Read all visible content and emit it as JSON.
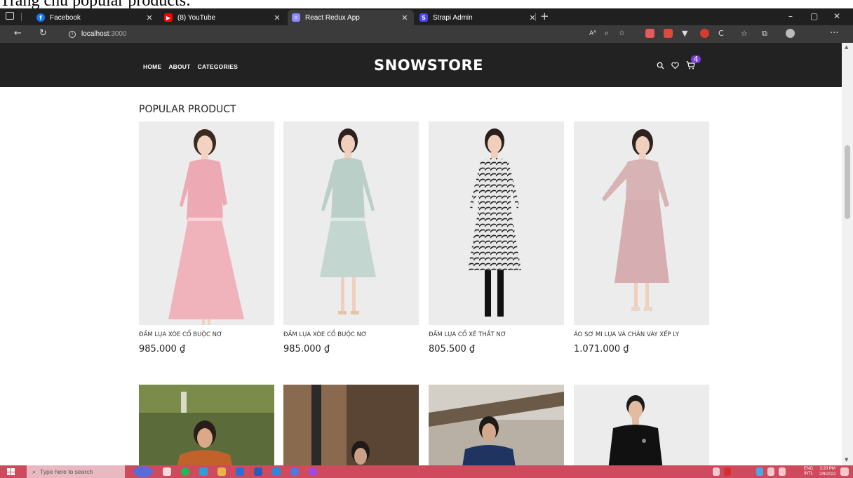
{
  "caption": "Trang chủ popular products:",
  "browser": {
    "tabs": [
      {
        "title": "Facebook",
        "icon": "facebook-icon",
        "color": "#1877f2"
      },
      {
        "title": "(8) YouTube",
        "icon": "youtube-icon",
        "color": "#ff0000"
      },
      {
        "title": "React Redux App",
        "icon": "react-icon",
        "color": "#8a8aff"
      },
      {
        "title": "Strapi Admin",
        "icon": "strapi-icon",
        "color": "#4945ff"
      }
    ],
    "new_tab": "+",
    "url_host": "localhost",
    "url_port": ":3000"
  },
  "site": {
    "nav": [
      "HOME",
      "ABOUT",
      "CATEGORIES"
    ],
    "brand": "SNOWSTORE",
    "cart_count": "4"
  },
  "section_title": "POPULAR PRODUCT",
  "products": [
    {
      "name": "ĐẦM LỤA XÒE CỔ BUỘC NƠ",
      "price": "985.000 ₫",
      "dress_color": "#eeaab4"
    },
    {
      "name": "ĐẦM LỤA XÒE CỔ BUỘC NƠ",
      "price": "985.000 ₫",
      "dress_color": "#b9cfc8"
    },
    {
      "name": "ĐẦM LỤA CỔ XẺ THẮT NƠ",
      "price": "805.500 ₫",
      "dress_color": "#4a4a4a"
    },
    {
      "name": "ÁO SƠ MI LỤA VÀ CHÂN VÁY XẾP LY",
      "price": "1.071.000 ₫",
      "dress_color": "#d6aeb1"
    }
  ],
  "taskbar": {
    "search_placeholder": "Type here to search",
    "lang": "ENG",
    "lang_sub": "INTL",
    "time": "3:20 PM",
    "date": "2/9/2022"
  }
}
